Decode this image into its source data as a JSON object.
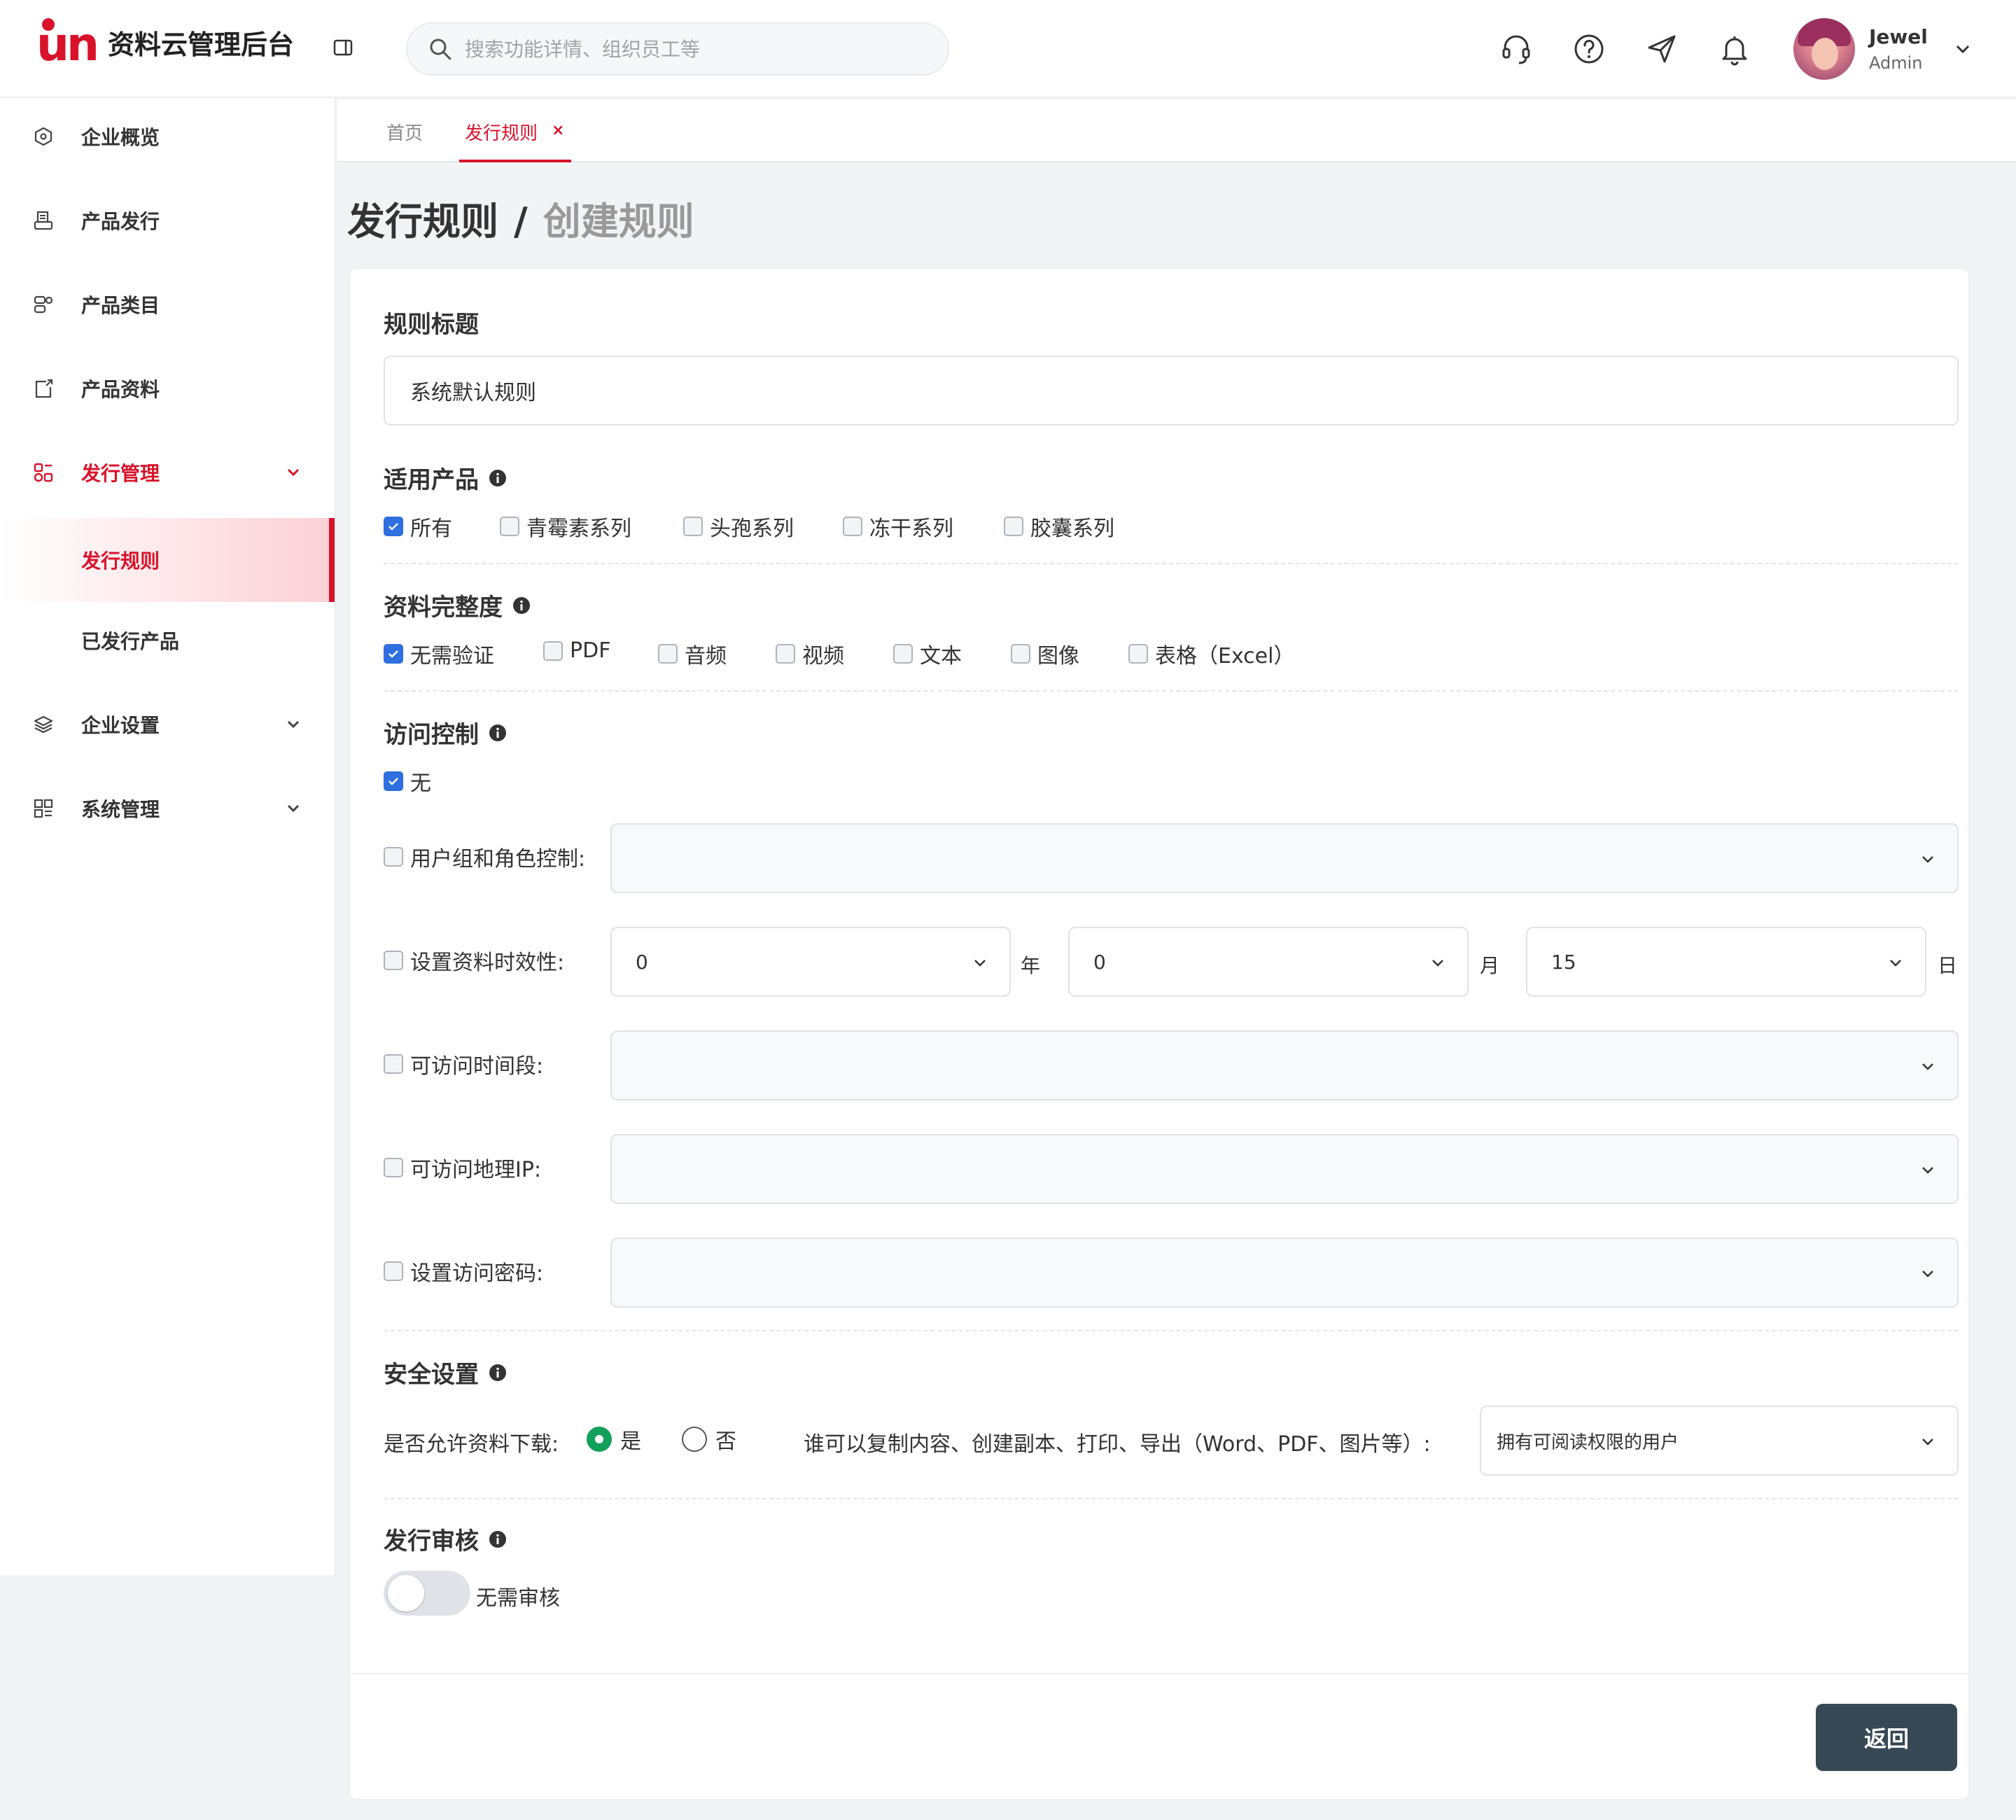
{
  "app": {
    "logo_mark": "un",
    "title": "资料云管理后台"
  },
  "search": {
    "placeholder": "搜索功能详情、组织员工等"
  },
  "user": {
    "name": "Jewel",
    "role": "Admin"
  },
  "sidebar": {
    "items": [
      {
        "label": "企业概览"
      },
      {
        "label": "产品发行"
      },
      {
        "label": "产品类目"
      },
      {
        "label": "产品资料"
      },
      {
        "label": "发行管理"
      },
      {
        "label": "发行规则"
      },
      {
        "label": "已发行产品"
      },
      {
        "label": "企业设置"
      },
      {
        "label": "系统管理"
      }
    ]
  },
  "tabs": [
    {
      "label": "首页"
    },
    {
      "label": "发行规则"
    }
  ],
  "tab_close": "×",
  "page": {
    "title": "发行规则",
    "separator": "/",
    "subtitle": "创建规则"
  },
  "form": {
    "rule_title": {
      "label": "规则标题",
      "value": "系统默认规则"
    },
    "products": {
      "label": "适用产品",
      "options": [
        {
          "label": "所有",
          "checked": true
        },
        {
          "label": "青霉素系列",
          "checked": false
        },
        {
          "label": "头孢系列",
          "checked": false
        },
        {
          "label": "冻干系列",
          "checked": false
        },
        {
          "label": "胶囊系列",
          "checked": false
        }
      ]
    },
    "completeness": {
      "label": "资料完整度",
      "options": [
        {
          "label": "无需验证",
          "checked": true
        },
        {
          "label": "PDF",
          "checked": false
        },
        {
          "label": "音频",
          "checked": false
        },
        {
          "label": "视频",
          "checked": false
        },
        {
          "label": "文本",
          "checked": false
        },
        {
          "label": "图像",
          "checked": false
        },
        {
          "label": "表格（Excel）",
          "checked": false
        }
      ]
    },
    "access": {
      "label": "访问控制",
      "none_label": "无",
      "none_checked": true,
      "rows": [
        {
          "label": "用户组和角色控制:"
        },
        {
          "label": "设置资料时效性:"
        },
        {
          "label": "可访问时间段:"
        },
        {
          "label": "可访问地理IP:"
        },
        {
          "label": "设置访问密码:"
        }
      ],
      "validity": {
        "year_value": "0",
        "year_unit": "年",
        "month_value": "0",
        "month_unit": "月",
        "day_value": "15",
        "day_unit": "日"
      }
    },
    "security": {
      "label": "安全设置",
      "download_label": "是否允许资料下载:",
      "yes_label": "是",
      "no_label": "否",
      "download_allowed": true,
      "copy_label": "谁可以复制内容、创建副本、打印、导出（Word、PDF、图片等）:",
      "copy_value": "拥有可阅读权限的用户"
    },
    "review": {
      "label": "发行审核",
      "toggle_label": "无需审核",
      "enabled": false
    }
  },
  "actions": {
    "back_label": "返回"
  },
  "colors": {
    "brand": "#d8122a",
    "checkbox": "#2f6fdf",
    "radio": "#12a05a",
    "button": "#374855"
  }
}
